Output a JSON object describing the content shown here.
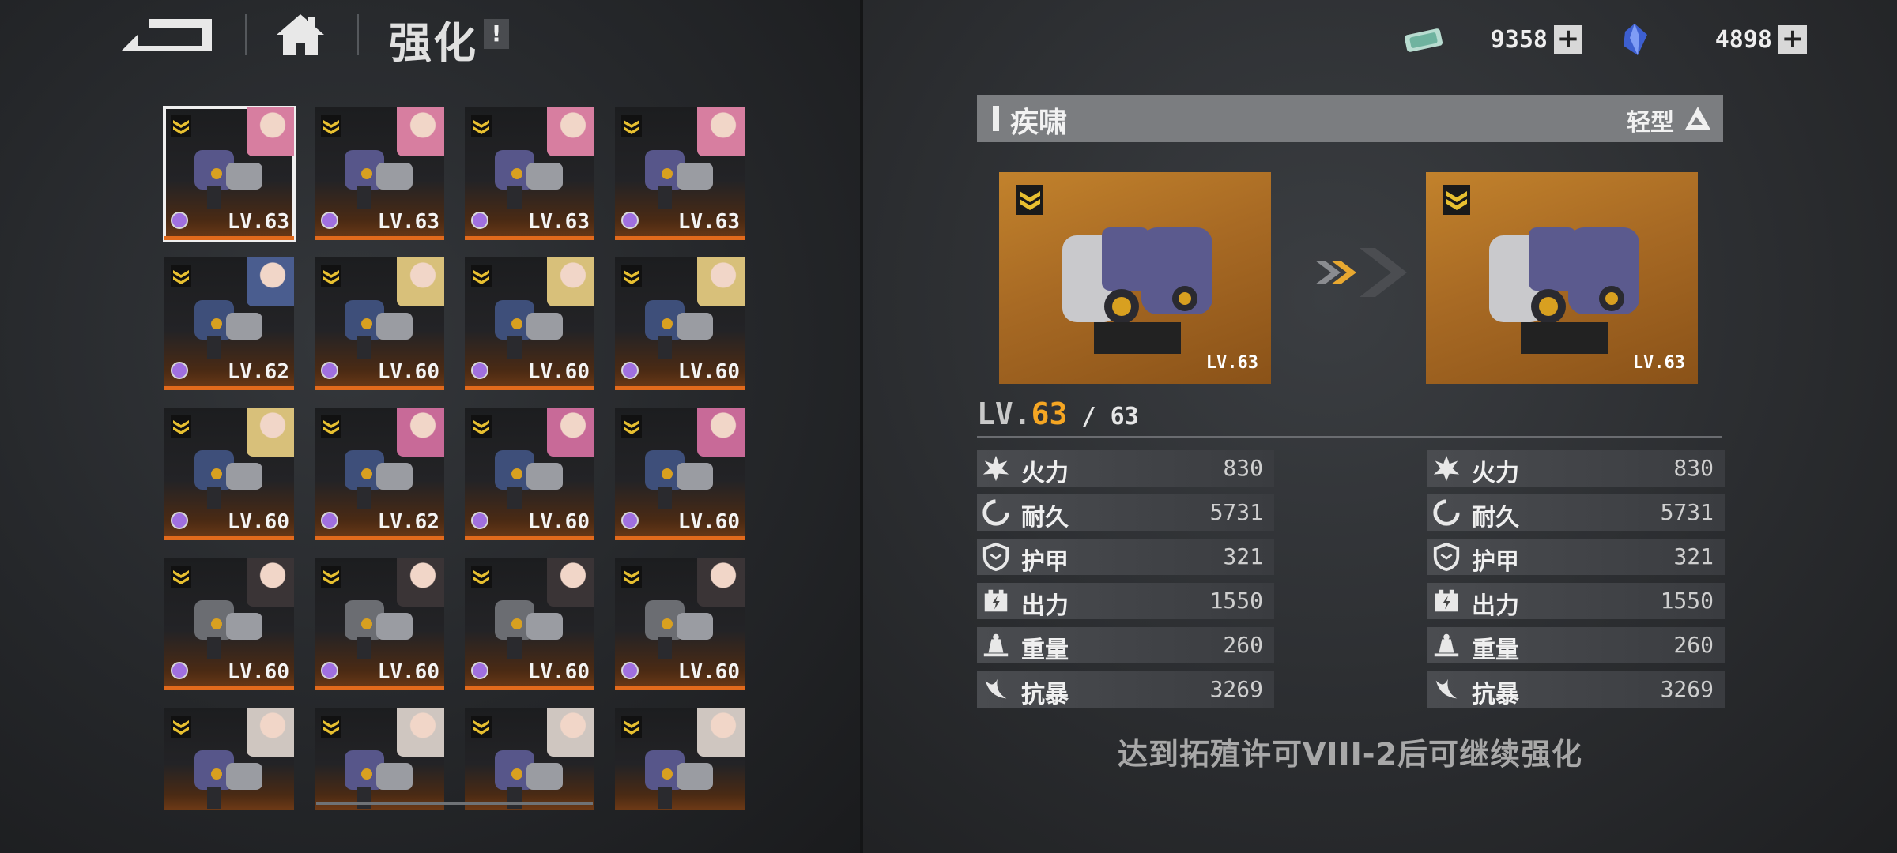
{
  "header": {
    "title": "强化",
    "info_label": "!"
  },
  "currencies": [
    {
      "icon": "ticket-icon",
      "amount": "9358",
      "plus": "+"
    },
    {
      "icon": "crystal-icon",
      "amount": "4898",
      "plus": "+"
    }
  ],
  "colors": {
    "accent_orange": "#e26a1c",
    "level_gold": "#f5a623",
    "preview_bg": "#b07028",
    "rarity_purple": "#a070e0"
  },
  "grid": {
    "cards": [
      {
        "lv": "LV.63",
        "selected": true,
        "pilot": "pink-hair-pilot"
      },
      {
        "lv": "LV.63",
        "selected": false,
        "pilot": "pink-hair-pilot"
      },
      {
        "lv": "LV.63",
        "selected": false,
        "pilot": "pink-hair-pilot"
      },
      {
        "lv": "LV.63",
        "selected": false,
        "pilot": "pink-hair-pilot"
      },
      {
        "lv": "LV.62",
        "selected": false,
        "pilot": "blue-hair-pilot"
      },
      {
        "lv": "LV.60",
        "selected": false,
        "pilot": "blonde-pilot"
      },
      {
        "lv": "LV.60",
        "selected": false,
        "pilot": "blonde-pilot"
      },
      {
        "lv": "LV.60",
        "selected": false,
        "pilot": "blonde-pilot"
      },
      {
        "lv": "LV.60",
        "selected": false,
        "pilot": "blonde-pilot"
      },
      {
        "lv": "LV.62",
        "selected": false,
        "pilot": "pink-hair-pilot-2"
      },
      {
        "lv": "LV.60",
        "selected": false,
        "pilot": "pink-hair-pilot-2"
      },
      {
        "lv": "LV.60",
        "selected": false,
        "pilot": "pink-hair-pilot-2"
      },
      {
        "lv": "LV.60",
        "selected": false,
        "pilot": "dark-hair-pilot"
      },
      {
        "lv": "LV.60",
        "selected": false,
        "pilot": "dark-hair-pilot"
      },
      {
        "lv": "LV.60",
        "selected": false,
        "pilot": "dark-hair-pilot"
      },
      {
        "lv": "LV.60",
        "selected": false,
        "pilot": "dark-hair-pilot"
      },
      {
        "lv": "",
        "selected": false,
        "pilot": "silver-hair-pilot"
      },
      {
        "lv": "",
        "selected": false,
        "pilot": "silver-hair-pilot"
      },
      {
        "lv": "",
        "selected": false,
        "pilot": "silver-hair-pilot"
      },
      {
        "lv": "",
        "selected": false,
        "pilot": "silver-hair-pilot"
      }
    ]
  },
  "detail": {
    "name": "疾啸",
    "type": "轻型",
    "preview_before_lv": "LV.63",
    "preview_after_lv": "LV.63",
    "level_prefix": "LV.",
    "level_current": "63",
    "level_max": " / 63",
    "stats_before": [
      {
        "icon": "firepower-icon",
        "label": "火力",
        "value": "830"
      },
      {
        "icon": "durability-icon",
        "label": "耐久",
        "value": "5731"
      },
      {
        "icon": "armor-icon",
        "label": "护甲",
        "value": "321"
      },
      {
        "icon": "power-icon",
        "label": "出力",
        "value": "1550"
      },
      {
        "icon": "weight-icon",
        "label": "重量",
        "value": "260"
      },
      {
        "icon": "resist-icon",
        "label": "抗暴",
        "value": "3269"
      }
    ],
    "stats_after": [
      {
        "icon": "firepower-icon",
        "label": "火力",
        "value": "830"
      },
      {
        "icon": "durability-icon",
        "label": "耐久",
        "value": "5731"
      },
      {
        "icon": "armor-icon",
        "label": "护甲",
        "value": "321"
      },
      {
        "icon": "power-icon",
        "label": "出力",
        "value": "1550"
      },
      {
        "icon": "weight-icon",
        "label": "重量",
        "value": "260"
      },
      {
        "icon": "resist-icon",
        "label": "抗暴",
        "value": "3269"
      }
    ],
    "notice": "达到拓殖许可VIII-2后可继续强化"
  }
}
